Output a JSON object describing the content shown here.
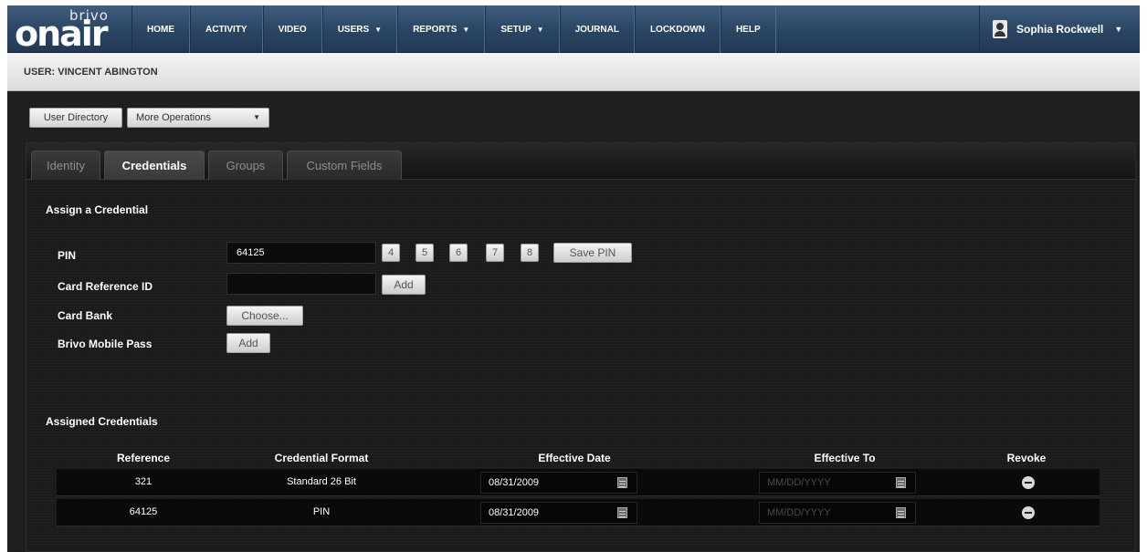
{
  "logo": {
    "brand_small": "brivo",
    "brand_large": "onair"
  },
  "nav": {
    "items": [
      {
        "label": "HOME",
        "caret": ""
      },
      {
        "label": "ACTIVITY",
        "caret": ""
      },
      {
        "label": "VIDEO",
        "caret": ""
      },
      {
        "label": "USERS",
        "caret": "▼"
      },
      {
        "label": "REPORTS",
        "caret": "▼"
      },
      {
        "label": "SETUP",
        "caret": "▼"
      },
      {
        "label": "JOURNAL",
        "caret": ""
      },
      {
        "label": "LOCKDOWN",
        "caret": ""
      },
      {
        "label": "HELP",
        "caret": ""
      }
    ],
    "user_name": "Sophia Rockwell",
    "user_caret": "▼"
  },
  "header": {
    "title": "USER: VINCENT ABINGTON"
  },
  "toolbar": {
    "user_directory_label": "User Directory",
    "more_operations_label": "More Operations",
    "more_caret": "▼"
  },
  "tabs": [
    {
      "label": "Identity"
    },
    {
      "label": "Credentials"
    },
    {
      "label": "Groups"
    },
    {
      "label": "Custom Fields"
    }
  ],
  "assign": {
    "title": "Assign a Credential",
    "pin_label": "PIN",
    "pin_value": "64125",
    "pin_length_options": [
      "4",
      "5",
      "6",
      "7",
      "8"
    ],
    "save_pin_label": "Save PIN",
    "card_ref_label": "Card Reference ID",
    "card_ref_value": "",
    "card_add_label": "Add",
    "card_bank_label": "Card Bank",
    "card_bank_button": "Choose...",
    "mobile_pass_label": "Brivo Mobile Pass",
    "mobile_add_label": "Add"
  },
  "assigned": {
    "title": "Assigned Credentials",
    "columns": [
      "Reference",
      "Credential Format",
      "Effective Date",
      "Effective To",
      "Revoke"
    ],
    "date_placeholder": "MM/DD/YYYY",
    "rows": [
      {
        "reference": "321",
        "format": "Standard 26 Bit",
        "effective_date": "08/31/2009",
        "effective_to": ""
      },
      {
        "reference": "64125",
        "format": "PIN",
        "effective_date": "08/31/2009",
        "effective_to": ""
      }
    ]
  },
  "colors": {
    "nav_blue": "#2a4563",
    "panel_dark": "#1a1a1a",
    "accent_white": "#ffffff"
  }
}
